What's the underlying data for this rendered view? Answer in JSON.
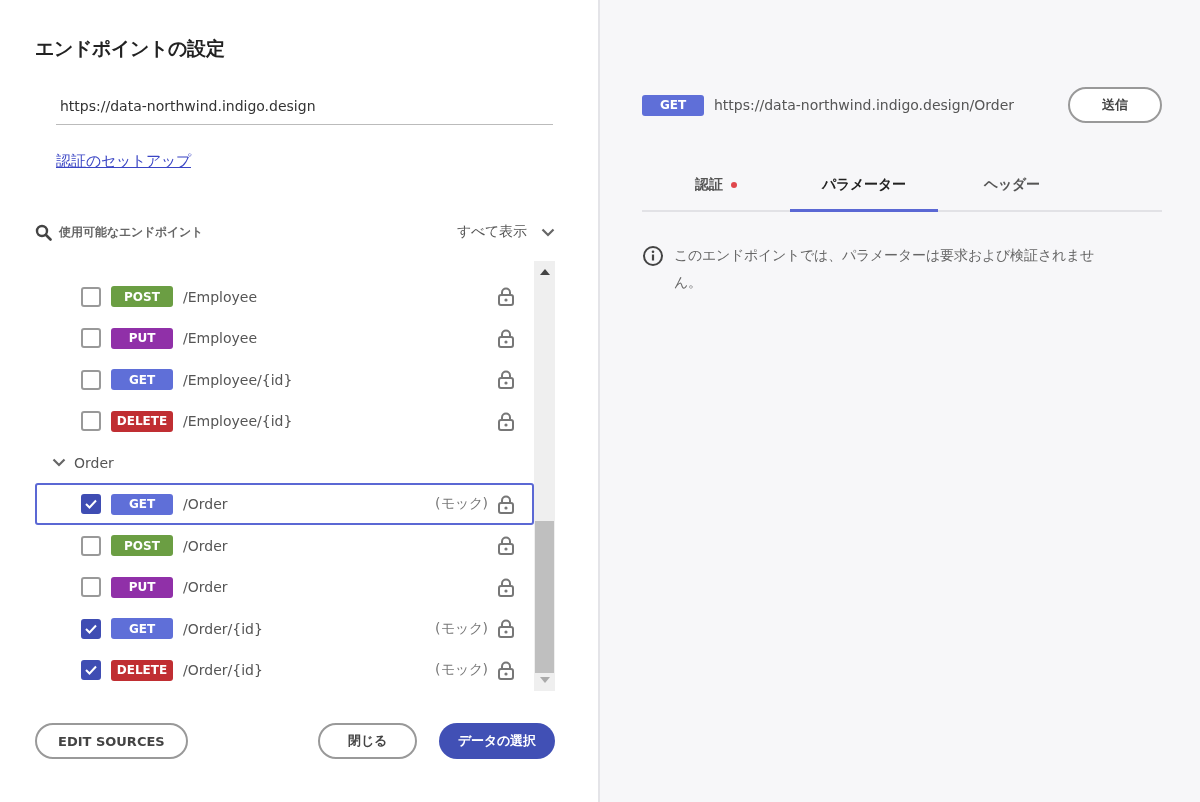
{
  "dialog": {
    "title": "エンドポイントの設定",
    "url_field": {
      "value": "https://data-northwind.indigo.design"
    },
    "auth_link": "認証のセットアップ",
    "search": {
      "label": "使用可能なエンドポイント"
    },
    "filter": {
      "value": "すべて表示"
    },
    "endpoints": [
      {
        "kind": "endpoint",
        "method": "POST",
        "color": "#6b9e43",
        "path": "/Employee",
        "checked": false,
        "selected": false
      },
      {
        "kind": "endpoint",
        "method": "PUT",
        "color": "#9030a8",
        "path": "/Employee",
        "checked": false,
        "selected": false
      },
      {
        "kind": "endpoint",
        "method": "GET",
        "color": "#5f6fd8",
        "path": "/Employee/{id}",
        "checked": false,
        "selected": false
      },
      {
        "kind": "endpoint",
        "method": "DELETE",
        "color": "#c02e32",
        "path": "/Employee/{id}",
        "checked": false,
        "selected": false
      },
      {
        "kind": "group",
        "label": "Order",
        "expanded": true
      },
      {
        "kind": "endpoint",
        "method": "GET",
        "color": "#5f6fd8",
        "path": "/Order",
        "mock": "(モック)",
        "checked": true,
        "selected": true
      },
      {
        "kind": "endpoint",
        "method": "POST",
        "color": "#6b9e43",
        "path": "/Order",
        "checked": false,
        "selected": false
      },
      {
        "kind": "endpoint",
        "method": "PUT",
        "color": "#9030a8",
        "path": "/Order",
        "checked": false,
        "selected": false
      },
      {
        "kind": "endpoint",
        "method": "GET",
        "color": "#5f6fd8",
        "path": "/Order/{id}",
        "mock": "(モック)",
        "checked": true,
        "selected": false
      },
      {
        "kind": "endpoint",
        "method": "DELETE",
        "color": "#c02e32",
        "path": "/Order/{id}",
        "mock": "(モック)",
        "checked": true,
        "selected": false
      }
    ],
    "buttons": {
      "edit_sources": "EDIT SOURCES",
      "close": "閉じる",
      "select_data": "データの選択"
    }
  },
  "request": {
    "method": "GET",
    "url": "https://data-northwind.indigo.design/Order",
    "send": "送信",
    "tabs": [
      {
        "label": "認証",
        "selected": false,
        "alert": true
      },
      {
        "label": "パラメーター",
        "selected": true,
        "alert": false
      },
      {
        "label": "ヘッダー",
        "selected": false,
        "alert": false
      }
    ],
    "info": "このエンドポイントでは、パラメーターは要求および検証されません。"
  }
}
